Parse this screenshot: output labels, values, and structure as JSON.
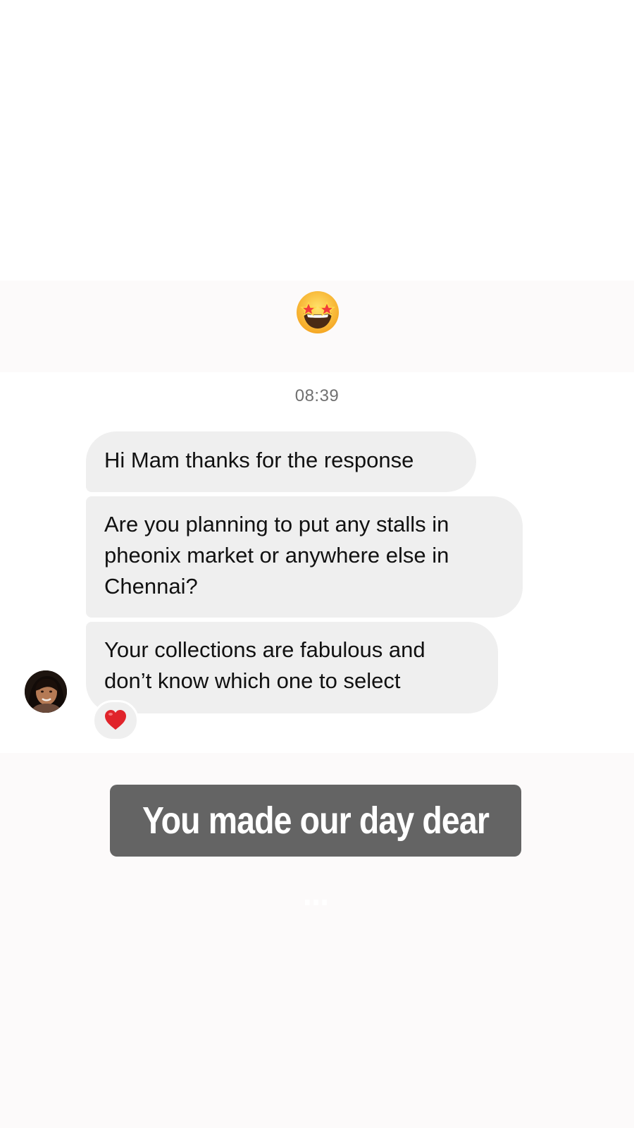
{
  "story": {
    "emoji_icon": "star-struck-emoji",
    "sticker_text": "You made our day dear ..."
  },
  "chat": {
    "timestamp": "08:39",
    "messages": [
      {
        "text": "Hi Mam thanks for the response"
      },
      {
        "text": "Are you planning to put any stalls in\npheonix market or anywhere else in\nChennai?"
      },
      {
        "text": "Your collections are fabulous and\ndon’t know which one to select"
      }
    ],
    "reaction_icon": "red-heart-icon",
    "avatar_icon": "user-avatar"
  },
  "colors": {
    "bubble": "#efefef",
    "sticker_bg": "#646464",
    "background": "#fcfafa"
  }
}
